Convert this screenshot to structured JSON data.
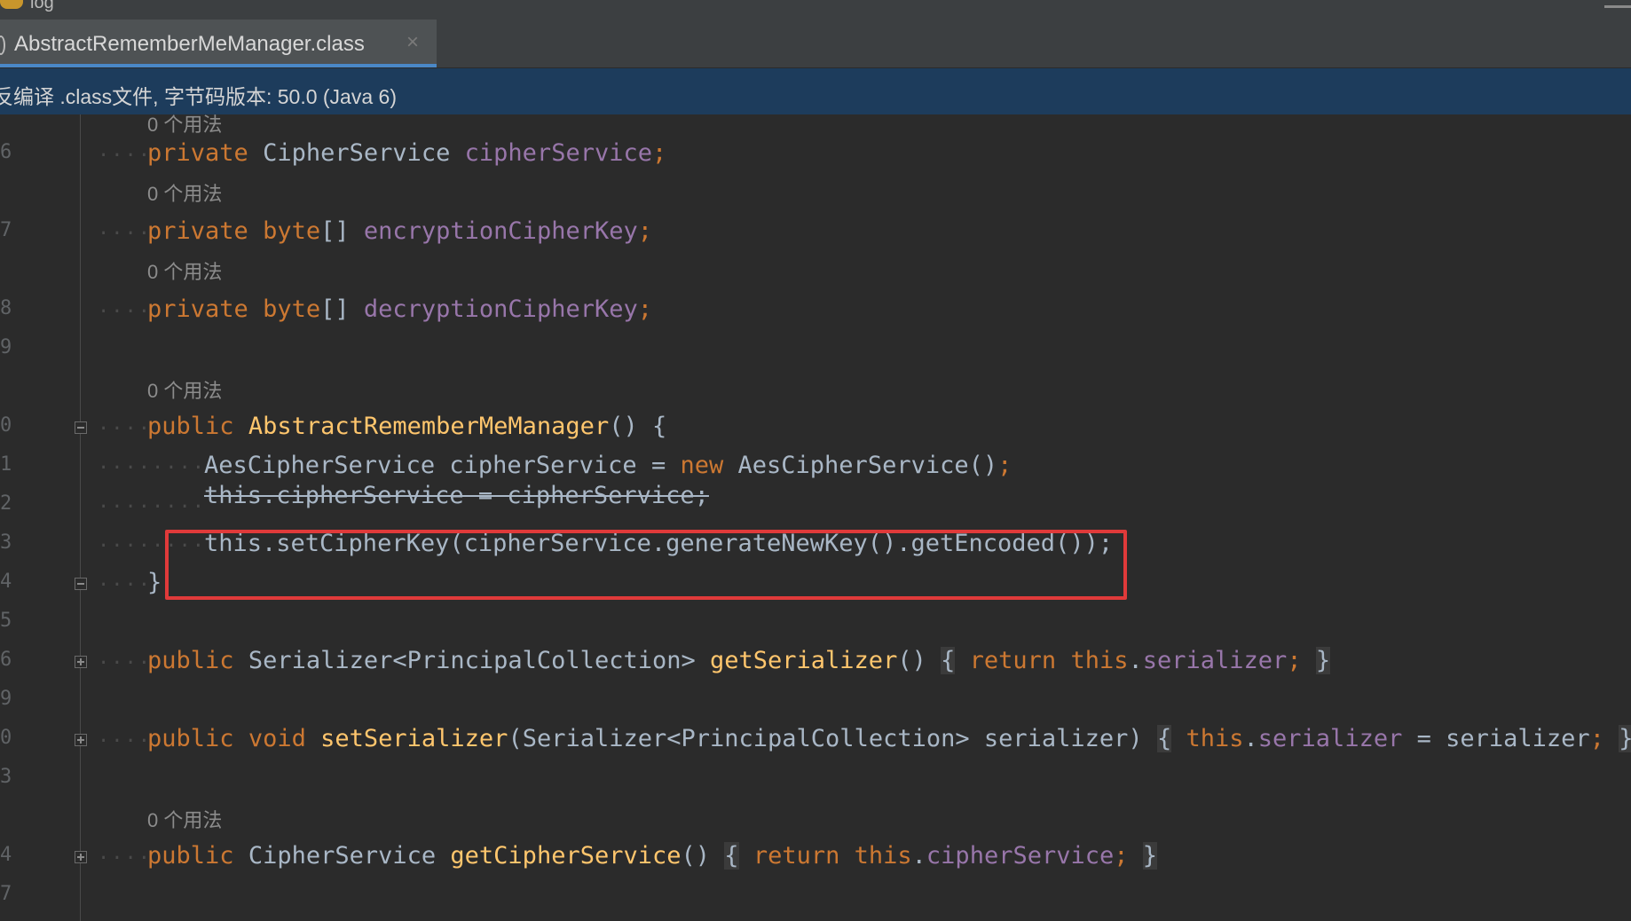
{
  "project": {
    "name": "log"
  },
  "tab": {
    "label": "AbstractRememberMeManager.class",
    "close": "×"
  },
  "notice": {
    "text": "反编译 .class文件, 字节码版本: 50.0 (Java 6)"
  },
  "hints": {
    "usages": "0 个用法"
  },
  "lines": {
    "l6": "6",
    "l7": "7",
    "l8": "8",
    "l9": "9",
    "l10": "0",
    "l11": "1",
    "l12": "2",
    "l13": "3",
    "l14": "4",
    "l15": "5",
    "l16": "6",
    "l19": "9",
    "l20": "0",
    "l23": "3",
    "l24": "4",
    "l27": "7"
  },
  "code": {
    "private": "private",
    "public": "public",
    "void": "void",
    "new": "new",
    "this": "this",
    "return": "return",
    "byte_arr": "byte",
    "cipherServiceType": "CipherService",
    "cipherServiceField": "cipherService",
    "encKey": "encryptionCipherKey",
    "decKey": "decryptionCipherKey",
    "ctorName": "AbstractRememberMeManager",
    "aesType": "AesCipherService",
    "aesVar": "cipherService",
    "aesCtor": "AesCipherService",
    "strikeLine": "this.cipherService = cipherService;",
    "setCipherKeyCall": "this.setCipherKey(cipherService.generateNewKey().getEncoded());",
    "serializerType": "Serializer<PrincipalCollection>",
    "getSerializer": "getSerializer",
    "serializerField": "serializer",
    "setSerializer": "setSerializer",
    "serializerParam": "(Serializer<PrincipalCollection> serializer)",
    "serializerVal": "serializer",
    "getCipherService": "getCipherService"
  }
}
